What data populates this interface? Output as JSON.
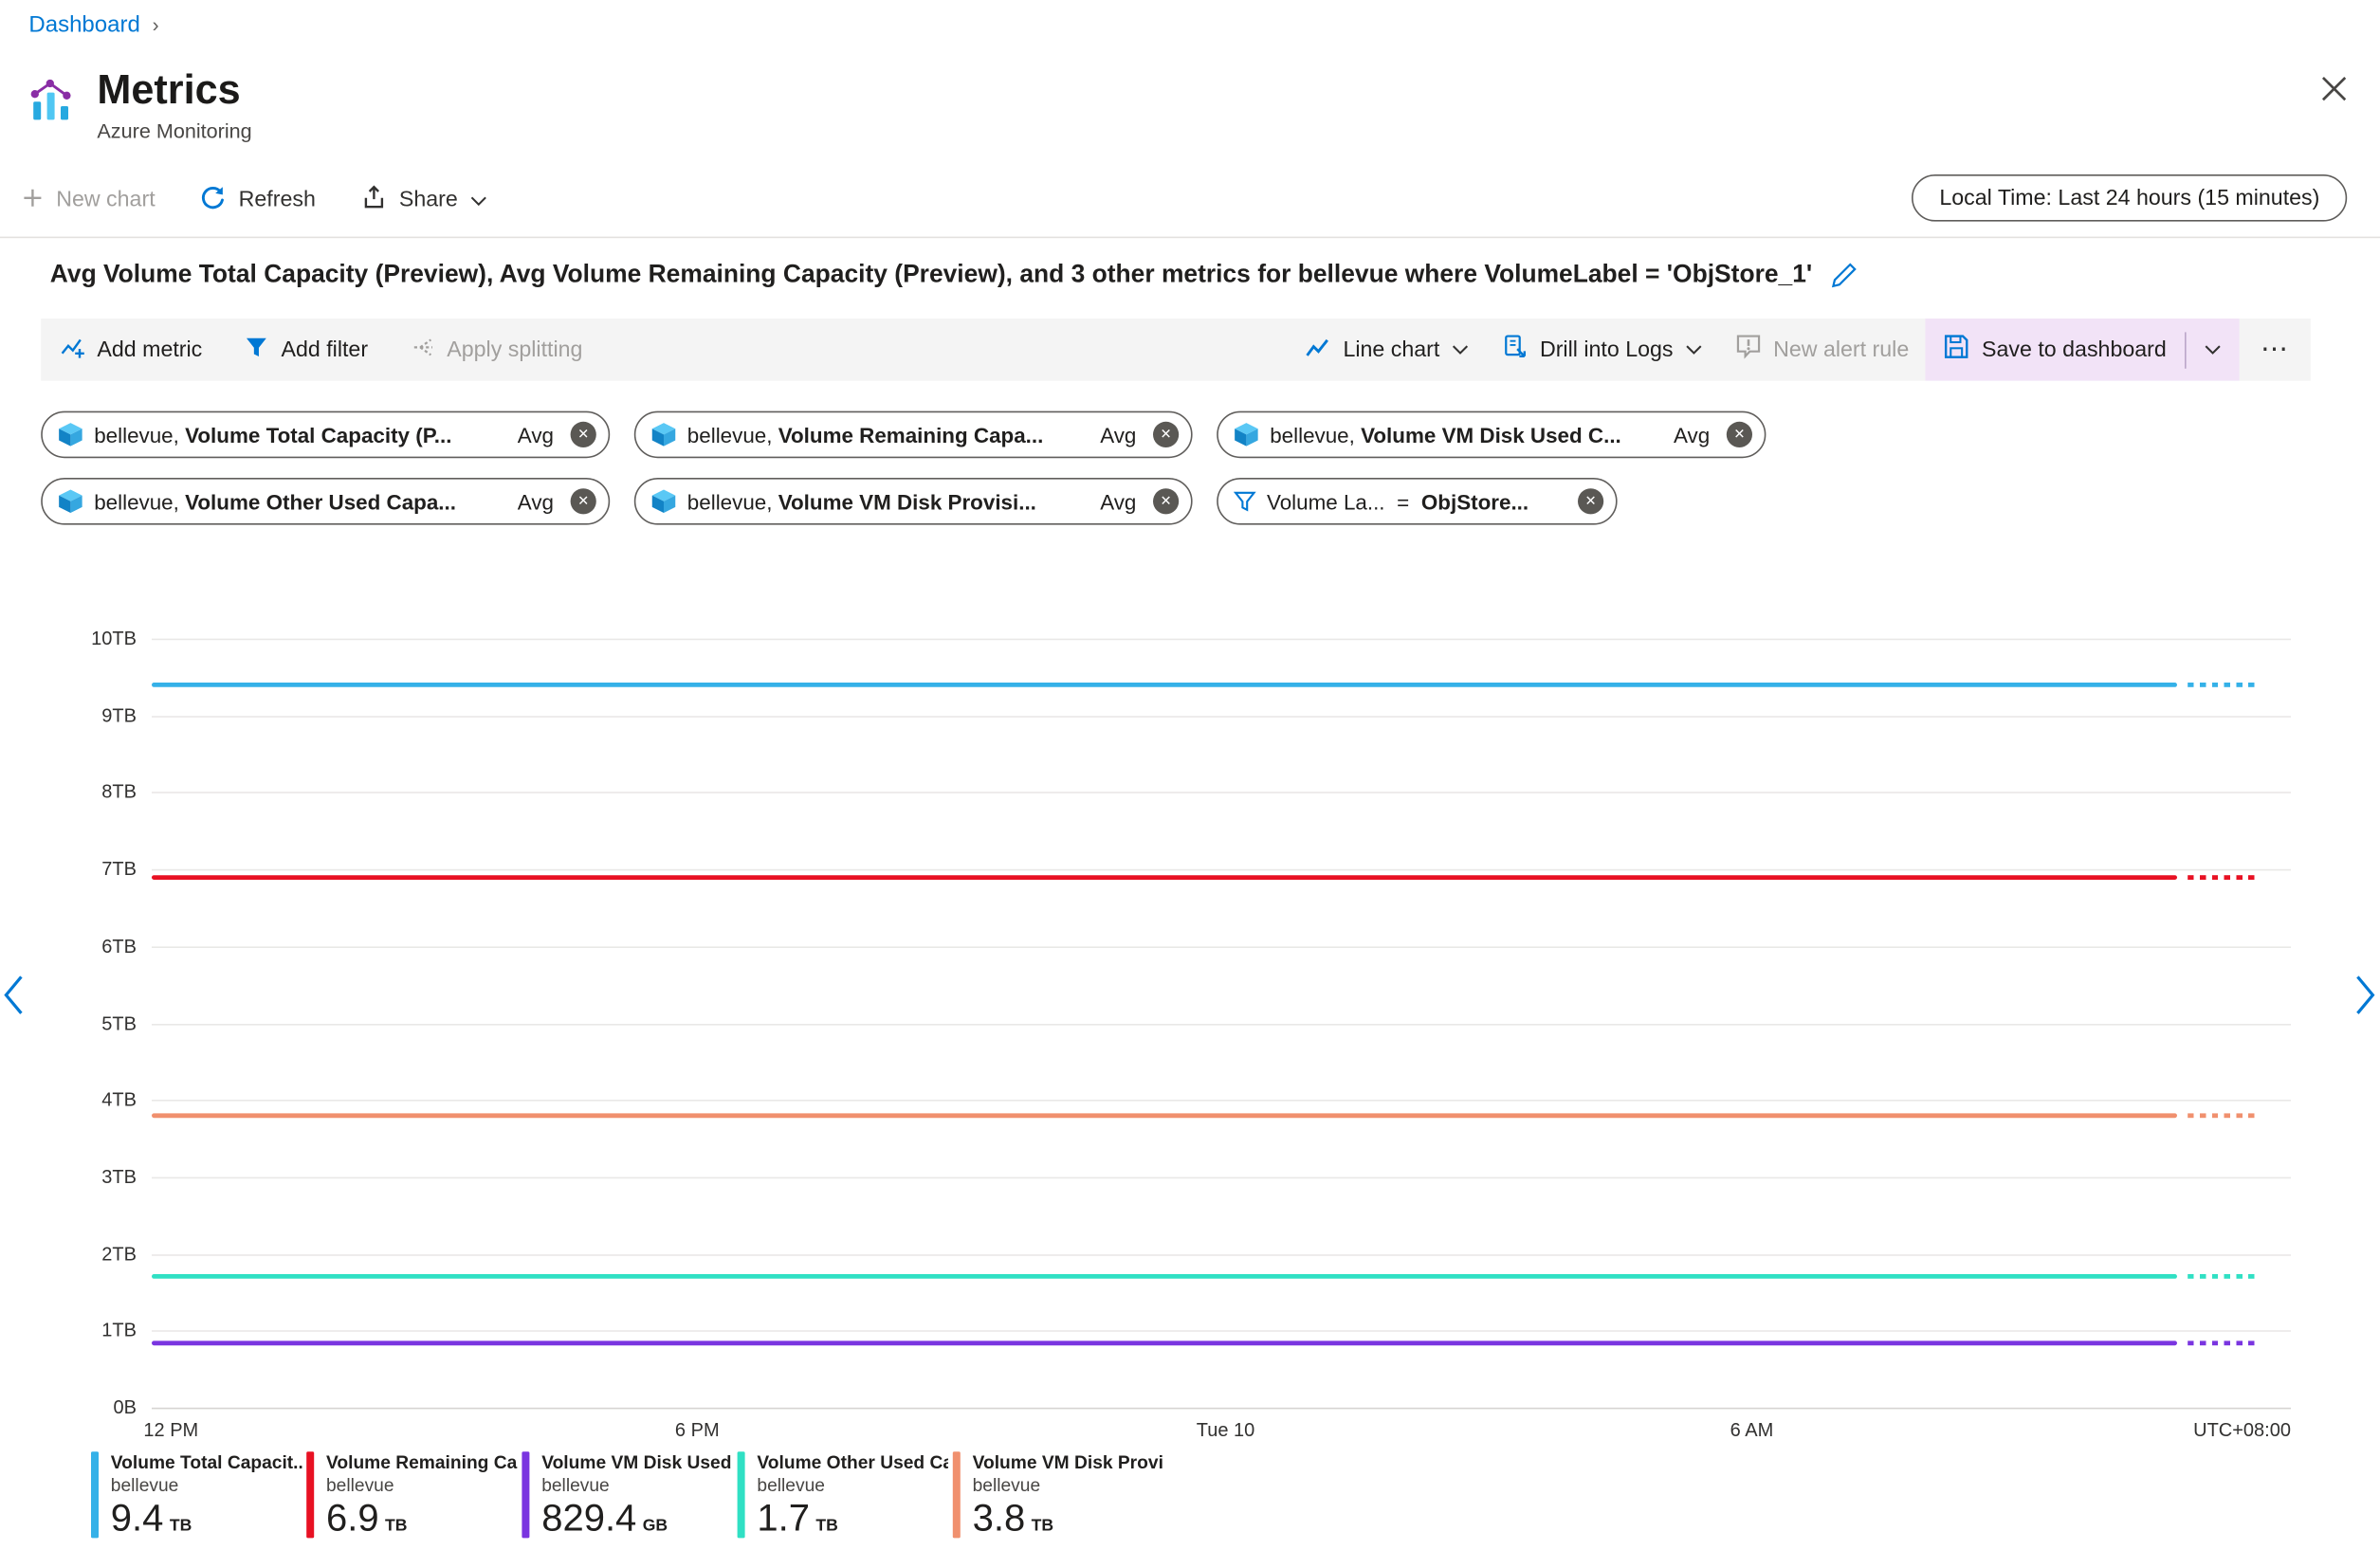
{
  "breadcrumb": {
    "dashboard": "Dashboard"
  },
  "header": {
    "title": "Metrics",
    "subtitle": "Azure Monitoring"
  },
  "toolbar": {
    "new_chart": "New chart",
    "refresh": "Refresh",
    "share": "Share",
    "time_range": "Local Time: Last 24 hours (15 minutes)"
  },
  "chart_header": {
    "title": "Avg Volume Total Capacity (Preview), Avg Volume Remaining Capacity (Preview), and 3 other metrics for bellevue where VolumeLabel = 'ObjStore_1'"
  },
  "chart_toolbar": {
    "add_metric": "Add metric",
    "add_filter": "Add filter",
    "apply_splitting": "Apply splitting",
    "line_chart": "Line chart",
    "drill_into_logs": "Drill into Logs",
    "new_alert_rule": "New alert rule",
    "save_to_dashboard": "Save to dashboard"
  },
  "icons": {
    "breadcrumb_chevron": "›",
    "remove": "✕",
    "more": "⋯"
  },
  "pills": [
    {
      "scope": "bellevue,",
      "metric": "Volume Total Capacity (P...",
      "agg": "Avg"
    },
    {
      "scope": "bellevue,",
      "metric": "Volume Remaining Capa...",
      "agg": "Avg"
    },
    {
      "scope": "bellevue,",
      "metric": "Volume VM Disk Used C...",
      "agg": "Avg"
    },
    {
      "scope": "bellevue,",
      "metric": "Volume Other Used Capa...",
      "agg": "Avg"
    },
    {
      "scope": "bellevue,",
      "metric": "Volume VM Disk Provisi...",
      "agg": "Avg"
    }
  ],
  "filter_pill": {
    "field": "Volume La...",
    "operator": "=",
    "value": "ObjStore..."
  },
  "chart_data": {
    "type": "line",
    "title": "Avg Volume Total Capacity (Preview), Avg Volume Remaining Capacity (Preview), and 3 other metrics for bellevue where VolumeLabel = 'ObjStore_1'",
    "ylim_tb": [
      0,
      10
    ],
    "y_ticks": [
      "10TB",
      "9TB",
      "8TB",
      "7TB",
      "6TB",
      "5TB",
      "4TB",
      "3TB",
      "2TB",
      "1TB",
      "0B"
    ],
    "y_tick_values_tb": [
      10,
      9,
      8,
      7,
      6,
      5,
      4,
      3,
      2,
      1,
      0
    ],
    "x_ticks": [
      "12 PM",
      "6 PM",
      "Tue 10",
      "6 AM"
    ],
    "timezone": "UTC+08:00",
    "grid": true,
    "legend_position": "bottom",
    "series": [
      {
        "name": "Volume Total Capacit...",
        "scope": "bellevue",
        "avg_value_tb": 9.4,
        "display_value": "9.4 TB",
        "color": "#35b1e8",
        "style": "flat-line-with-dashed-tail"
      },
      {
        "name": "Volume Remaining Cap...",
        "scope": "bellevue",
        "avg_value_tb": 6.9,
        "display_value": "6.9 TB",
        "color": "#e81123",
        "style": "flat-line-with-dashed-tail"
      },
      {
        "name": "Volume VM Disk Provi...",
        "scope": "bellevue",
        "avg_value_tb": 3.8,
        "display_value": "3.8 TB",
        "color": "#f0906e",
        "style": "flat-line-with-dashed-tail"
      },
      {
        "name": "Volume Other Used Ca...",
        "scope": "bellevue",
        "avg_value_tb": 1.7,
        "display_value": "1.7 TB",
        "color": "#30e0c4",
        "style": "flat-line-with-dashed-tail"
      },
      {
        "name": "Volume VM Disk Used ...",
        "scope": "bellevue",
        "avg_value_tb": 0.83,
        "display_value": "829.4 GB",
        "color": "#7a35e0",
        "style": "flat-line-with-dashed-tail"
      }
    ]
  },
  "legend": [
    {
      "name": "Volume Total Capacit...",
      "scope": "bellevue",
      "value": "9.4",
      "unit": "TB",
      "color": "#35b1e8"
    },
    {
      "name": "Volume Remaining Cap...",
      "scope": "bellevue",
      "value": "6.9",
      "unit": "TB",
      "color": "#e81123"
    },
    {
      "name": "Volume VM Disk Used ...",
      "scope": "bellevue",
      "value": "829.4",
      "unit": "GB",
      "color": "#7a35e0"
    },
    {
      "name": "Volume Other Used Ca...",
      "scope": "bellevue",
      "value": "1.7",
      "unit": "TB",
      "color": "#30e0c4"
    },
    {
      "name": "Volume VM Disk Provi...",
      "scope": "bellevue",
      "value": "3.8",
      "unit": "TB",
      "color": "#f0906e"
    }
  ],
  "colors": {
    "accent": "#0078d4",
    "save_highlight": "#f2e3f7",
    "disabled_text": "#a19f9d",
    "grid": "#e9e8e7"
  }
}
